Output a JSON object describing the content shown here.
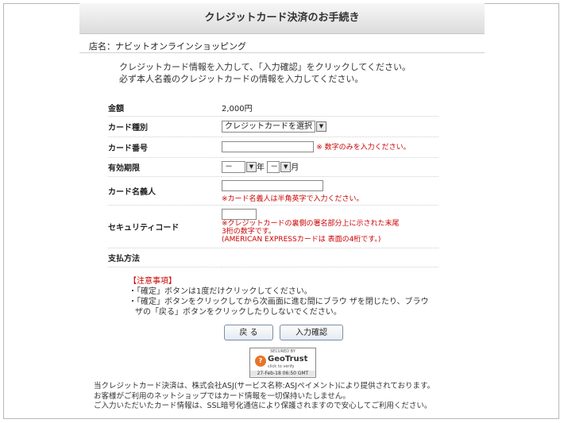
{
  "header": {
    "title": "クレジットカード決済のお手続き"
  },
  "shop": {
    "name": "店名：ナビットオンラインショッピング"
  },
  "intro": {
    "line1": "クレジットカード情報を入力して、「入力確認」をクリックしてください。",
    "line2": "必ず本人名義のクレジットカードの情報を入力してください。"
  },
  "form": {
    "amount_label": "金額",
    "amount_value": "2,000円",
    "card_type_label": "カード種別",
    "card_type_selected": "クレジットカードを選択",
    "card_number_label": "カード番号",
    "card_number_note": "※ 数字のみを入力ください。",
    "expiry_label": "有効期限",
    "expiry_year_value": "－",
    "expiry_year_suffix": "年",
    "expiry_month_value": "－",
    "expiry_month_suffix": "月",
    "holder_label": "カード名義人",
    "holder_note": "※カード名義人は半角英字で入力ください。",
    "cvc_label": "セキュリティコード",
    "cvc_note1": "※クレジットカードの裏側の署名部分上に示された末尾",
    "cvc_note2": "3桁の数字です。",
    "cvc_note3": "(AMERICAN EXPRESSカードは 表面の4桁です。)",
    "payment_label": "支払方法"
  },
  "notes": {
    "title": "【注意事項】",
    "item1": "・「確定」ボタンは1度だけクリックしてください。",
    "item2": "・「確定」ボタンをクリックしてから次画面に進む間にブラウ ザを閉じたり、ブラウ",
    "item3": "ザの「戻る」ボタンをクリックしたりしないでください。"
  },
  "buttons": {
    "back": "戻 る",
    "confirm": "入力確認"
  },
  "seal": {
    "secured_by": "SECURED BY",
    "brand": "GeoTrust",
    "click_verify": "click to verify",
    "date": "27-Feb-18 06:50 GMT"
  },
  "footer": {
    "line1": "当クレジットカード決済は、株式会社ASJ(サービス名称:ASJペイメント)により提供されております。",
    "line2": "お客様がご利用のネットショップではカード情報を一切保持いたしません。",
    "line3": "ご入力いただいたカード情報は、SSL暗号化通信により保護されますので安心してご利用ください。"
  },
  "colors": {
    "accent_red": "#cc0000",
    "header_bg": "#dcdcdc"
  },
  "icons": {
    "dropdown": "chevron-down-icon",
    "seal": "geotrust-logo-icon"
  }
}
